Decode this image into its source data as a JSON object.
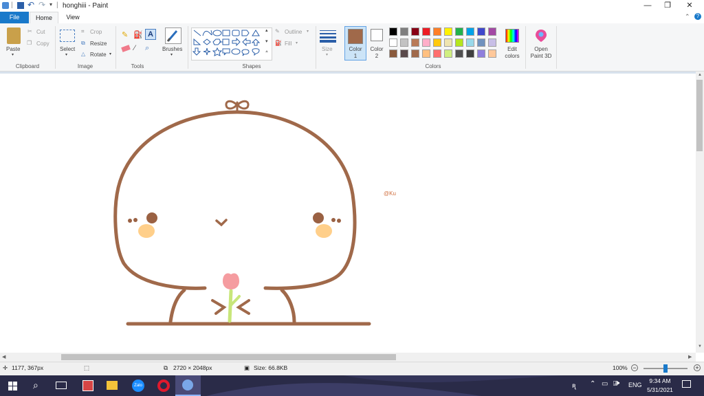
{
  "window": {
    "title": "honghiii - Paint",
    "minimize_glyph": "—",
    "maximize_glyph": "❐",
    "close_glyph": "✕"
  },
  "tabs": {
    "file": "File",
    "home": "Home",
    "view": "View"
  },
  "clipboard": {
    "paste": "Paste",
    "cut": "Cut",
    "copy": "Copy",
    "group": "Clipboard"
  },
  "image": {
    "select": "Select",
    "crop": "Crop",
    "resize": "Resize",
    "rotate": "Rotate",
    "group": "Image"
  },
  "tools": {
    "group": "Tools"
  },
  "brushes": {
    "label": "Brushes"
  },
  "shapes": {
    "outline": "Outline",
    "fill": "Fill",
    "group": "Shapes"
  },
  "size": {
    "label": "Size"
  },
  "color1": {
    "line1": "Color",
    "line2": "1",
    "color": "#a0694a"
  },
  "color2": {
    "line1": "Color",
    "line2": "2",
    "color": "#ffffff"
  },
  "colors": {
    "group": "Colors",
    "row1": [
      "#000000",
      "#7f7f7f",
      "#880015",
      "#ed1c24",
      "#ff7f27",
      "#fff200",
      "#22b14c",
      "#00a2e8",
      "#3f48cc",
      "#a349a4"
    ],
    "row2": [
      "#ffffff",
      "#c3c3c3",
      "#b97a57",
      "#ffaec9",
      "#ffc90e",
      "#efe4b0",
      "#b5e61d",
      "#99d9ea",
      "#7092be",
      "#c8bfe7"
    ],
    "row3": [
      "#8a5a3c",
      "#5a4a4a",
      "#a0694a",
      "#ffc080",
      "#ff6f6f",
      "#d0ef80",
      "#505050",
      "#404040",
      "#8f7fdc",
      "#ffc89a"
    ]
  },
  "edit_colors": {
    "line1": "Edit",
    "line2": "colors"
  },
  "paint3d": {
    "line1": "Open",
    "line2": "Paint 3D"
  },
  "drawing": {
    "watermark": "@Ku"
  },
  "status": {
    "cursor": "1177, 367px",
    "dimensions": "2720 × 2048px",
    "size": "Size: 66.8KB",
    "zoom": "100%"
  },
  "taskbar": {
    "lang": "ENG",
    "time": "9:34 AM",
    "date": "5/31/2021"
  }
}
